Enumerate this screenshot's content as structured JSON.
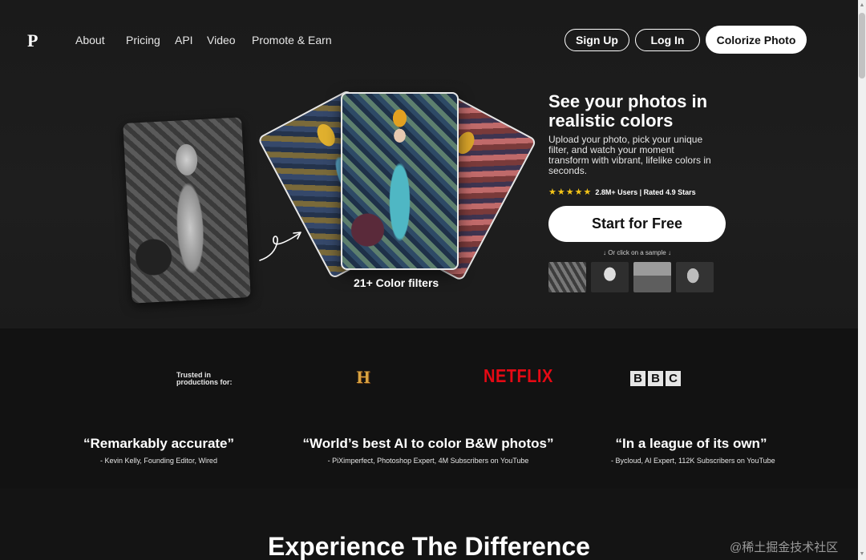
{
  "nav": {
    "logo": "P",
    "links": [
      "About",
      "Pricing",
      "API",
      "Video",
      "Promote & Earn"
    ],
    "signup_label": "Sign Up",
    "login_label": "Log In",
    "colorize_label": "Colorize Photo"
  },
  "hero": {
    "title": "See your photos in realistic colors",
    "description": "Upload your photo, pick your unique filter, and watch your moment transform with vibrant, lifelike colors in seconds.",
    "stars": "★★★★★",
    "rating_text": "2.8M+ Users | Rated 4.9 Stars",
    "cta_label": "Start for Free",
    "sample_hint": "↓ Or click on a sample ↓",
    "filters_label": "21+ Color filters"
  },
  "trusted": {
    "line1": "Trusted in",
    "line2": "productions for:",
    "history_logo": "H",
    "netflix_logo": "NETFLIX",
    "bbc_letters": [
      "B",
      "B",
      "C"
    ]
  },
  "quotes": [
    {
      "text": "“Remarkably accurate”",
      "author": "- Kevin Kelly, Founding Editor, Wired"
    },
    {
      "text": "“World’s best AI to color B&W photos”",
      "author": "- PiXimperfect, Photoshop Expert, 4M Subscribers on YouTube"
    },
    {
      "text": "“In a league of its own”",
      "author": "- Bycloud, AI Expert, 112K Subscribers on YouTube"
    }
  ],
  "section": {
    "title": "Experience The Difference"
  },
  "watermark": "@稀土掘金技术社区",
  "colors": {
    "background": "#141414",
    "button_bg": "#ffffff",
    "star": "#f5c518",
    "netflix": "#e50914"
  }
}
